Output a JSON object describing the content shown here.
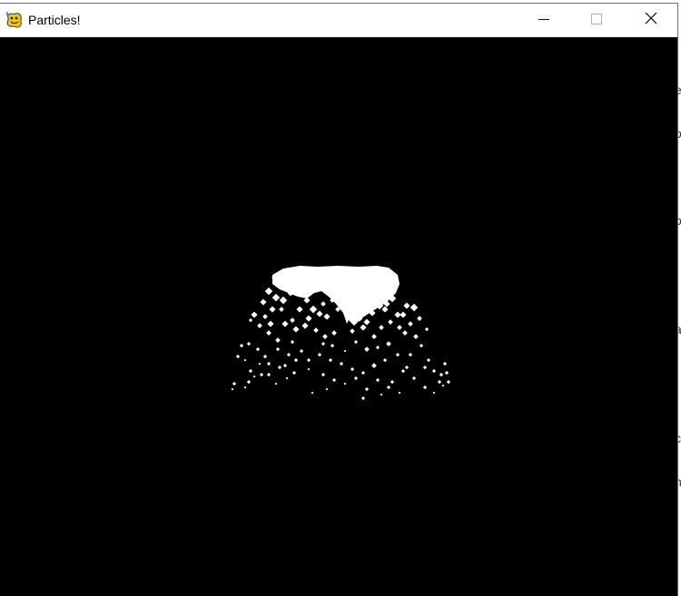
{
  "window": {
    "title": "Particles!",
    "icon": "pygame-snake-icon",
    "controls": {
      "minimize": "minimize-icon",
      "maximize": "maximize-icon",
      "close": "close-icon"
    },
    "colors": {
      "titlebar": "#ffffff",
      "canvas": "#000000",
      "particles": "#ffffff"
    }
  },
  "background_window": {
    "glyphs": [
      "e",
      "o",
      "o",
      "a",
      "c",
      "n"
    ]
  }
}
